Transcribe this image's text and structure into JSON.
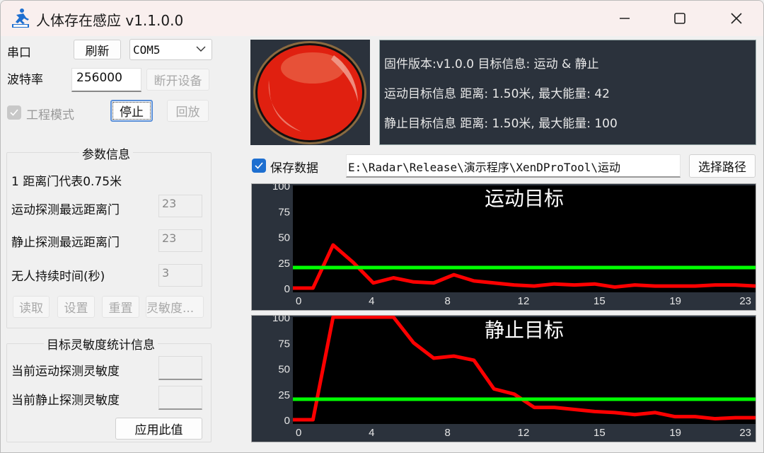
{
  "window": {
    "title": "人体存在感应 v1.1.0.0",
    "logo_icon": "running-person-logo-icon",
    "controls": [
      "minimize-icon",
      "maximize-icon",
      "close-icon"
    ]
  },
  "serial": {
    "port_label": "串口",
    "refresh_label": "刷新",
    "port_value": "COM5",
    "baud_label": "波特率",
    "baud_value": "256000",
    "disconnect_label": "断开设备",
    "engineering_mode_label": "工程模式",
    "engineering_mode_checked": true,
    "stop_label": "停止",
    "playback_label": "回放"
  },
  "params": {
    "title": "参数信息",
    "gate_note": "1 距离门代表0.75米",
    "rows": [
      {
        "label": "运动探测最远距离门",
        "value": "23"
      },
      {
        "label": "静止探测最远距离门",
        "value": "23"
      },
      {
        "label": "无人持续时间(秒)",
        "value": "3"
      }
    ],
    "buttons": [
      "读取",
      "设置",
      "重置",
      "灵敏度..."
    ]
  },
  "sensitivity": {
    "title": "目标灵敏度统计信息",
    "rows": [
      {
        "label": "当前运动探测灵敏度",
        "value": ""
      },
      {
        "label": "当前静止探测灵敏度",
        "value": ""
      }
    ],
    "apply_label": "应用此值"
  },
  "status": {
    "indicator_color": "#e02010",
    "lines": [
      "固件版本:v1.0.0 目标信息: 运动 & 静止",
      "运动目标信息 距离: 1.50米, 最大能量: 42",
      "静止目标信息 距离: 1.50米, 最大能量: 100"
    ]
  },
  "save": {
    "label": "保存数据",
    "checked": true,
    "path": "E:\\Radar\\Release\\演示程序\\XenDProTool\\运动",
    "choose_label": "选择路径"
  },
  "colors": {
    "series": "#ff0000",
    "threshold": "#00ff00",
    "panel_bg": "#2b323c",
    "plot_bg": "#000000",
    "checkbox_accent": "#1e6fd0"
  },
  "chart_data": [
    {
      "type": "line",
      "title": "运动目标",
      "xlabel": "",
      "ylabel": "",
      "x": [
        0,
        1,
        2,
        3,
        4,
        5,
        6,
        7,
        8,
        9,
        10,
        11,
        12,
        13,
        14,
        15,
        16,
        17,
        18,
        19,
        20,
        21,
        22,
        23
      ],
      "series": [
        {
          "name": "energy",
          "values": [
            0,
            0,
            42,
            25,
            5,
            10,
            6,
            5,
            13,
            7,
            5,
            3,
            2,
            4,
            3,
            4,
            1,
            3,
            2,
            2,
            2,
            3,
            3,
            2
          ]
        },
        {
          "name": "threshold",
          "values": [
            20,
            20,
            20,
            20,
            20,
            20,
            20,
            20,
            20,
            20,
            20,
            20,
            20,
            20,
            20,
            20,
            20,
            20,
            20,
            20,
            20,
            20,
            20,
            20
          ]
        }
      ],
      "xtick_labels": [
        "0",
        "4",
        "8",
        "12",
        "15",
        "19",
        "23"
      ],
      "ytick_labels": [
        "100",
        "75",
        "50",
        "25",
        "0"
      ],
      "xlim": [
        0,
        23
      ],
      "ylim": [
        0,
        100
      ],
      "grid": false,
      "legend": "none"
    },
    {
      "type": "line",
      "title": "静止目标",
      "xlabel": "",
      "ylabel": "",
      "x": [
        0,
        1,
        2,
        3,
        4,
        5,
        6,
        7,
        8,
        9,
        10,
        11,
        12,
        13,
        14,
        15,
        16,
        17,
        18,
        19,
        20,
        21,
        22,
        23
      ],
      "series": [
        {
          "name": "energy",
          "values": [
            0,
            0,
            100,
            100,
            100,
            100,
            75,
            60,
            62,
            58,
            30,
            25,
            12,
            12,
            10,
            8,
            7,
            5,
            7,
            3,
            3,
            1,
            2,
            2
          ]
        },
        {
          "name": "threshold",
          "values": [
            20,
            20,
            20,
            20,
            20,
            20,
            20,
            20,
            20,
            20,
            20,
            20,
            20,
            20,
            20,
            20,
            20,
            20,
            20,
            20,
            20,
            20,
            20,
            20
          ]
        }
      ],
      "xtick_labels": [
        "0",
        "4",
        "8",
        "12",
        "15",
        "19",
        "23"
      ],
      "ytick_labels": [
        "100",
        "75",
        "50",
        "25",
        "0"
      ],
      "xlim": [
        0,
        23
      ],
      "ylim": [
        0,
        100
      ],
      "grid": false,
      "legend": "none"
    }
  ]
}
